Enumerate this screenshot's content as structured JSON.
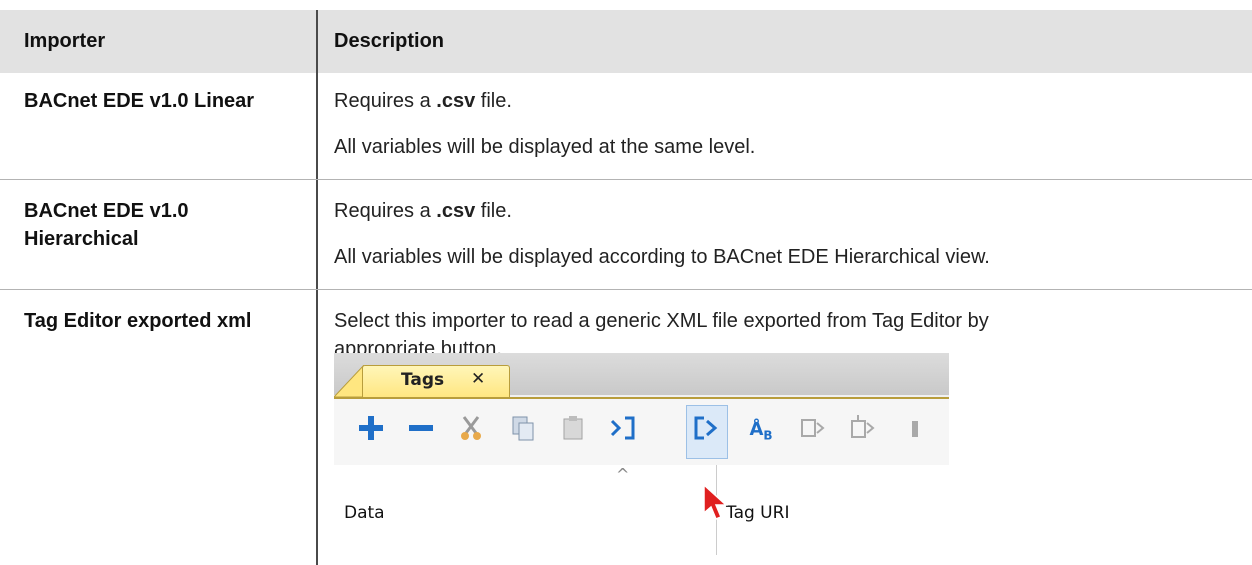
{
  "table": {
    "headers": {
      "importer": "Importer",
      "description": "Description"
    },
    "rows": [
      {
        "importer": "BACnet EDE v1.0 Linear",
        "desc_line1_pre": "Requires a ",
        "desc_line1_bold": ".csv",
        "desc_line1_post": " file.",
        "desc_line2": "All variables will be displayed at the same level."
      },
      {
        "importer": "BACnet EDE v1.0 Hierarchical",
        "desc_line1_pre": "Requires a ",
        "desc_line1_bold": ".csv",
        "desc_line1_post": " file.",
        "desc_line2": "All variables will be displayed according to BACnet EDE Hierarchical view."
      },
      {
        "importer": "Tag Editor exported xml",
        "desc": "Select this importer to read a generic XML file exported from Tag Editor by appropriate button."
      }
    ]
  },
  "screenshot": {
    "tab_label": "Tags",
    "tab_close": "✕",
    "toolbar_icons": [
      "plus-icon",
      "minus-icon",
      "cut-icon",
      "copy-icon",
      "paste-icon",
      "export-icon",
      "import-icon",
      "rename-icon",
      "tag-a-icon",
      "tag-b-icon",
      "more-icon"
    ],
    "columns": [
      "Data",
      "Tag URI"
    ],
    "sort_caret": "^"
  }
}
